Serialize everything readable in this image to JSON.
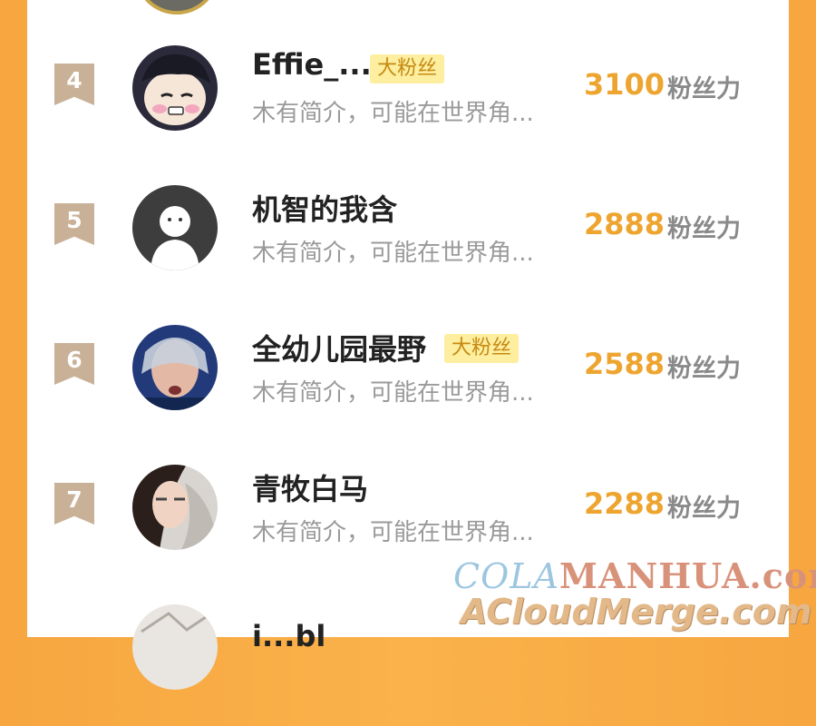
{
  "ranking": [
    {
      "rank": "4",
      "name": "Effie_...",
      "badge": "大粉丝",
      "intro": "木有简介，可能在世界角...",
      "score": "3100",
      "unit": "粉丝力"
    },
    {
      "rank": "5",
      "name": "机智的我含",
      "badge": "",
      "intro": "木有简介，可能在世界角...",
      "score": "2888",
      "unit": "粉丝力"
    },
    {
      "rank": "6",
      "name": "全幼儿园最野",
      "badge": "大粉丝",
      "intro": "木有简介，可能在世界角...",
      "score": "2588",
      "unit": "粉丝力"
    },
    {
      "rank": "7",
      "name": "青牧白马",
      "badge": "",
      "intro": "木有简介，可能在世界角...",
      "score": "2288",
      "unit": "粉丝力"
    },
    {
      "rank": "",
      "name": "i...bl",
      "badge": "",
      "intro": "",
      "score": "",
      "unit": ""
    }
  ],
  "watermark": {
    "line1_a": "COLA",
    "line1_b": "MANHUA.com",
    "line2": "ACloudMerge.com"
  },
  "colors": {
    "accent": "#eea530",
    "badge_bg": "#fdeea0",
    "rank_flag": "#c9b197",
    "background": "#f7a640"
  }
}
